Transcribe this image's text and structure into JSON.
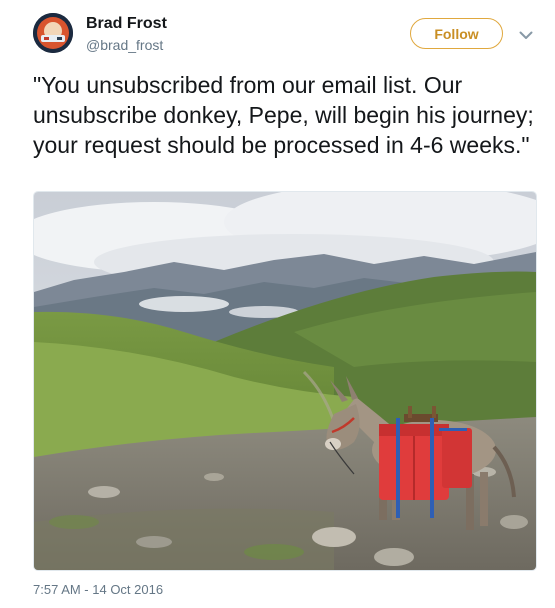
{
  "tweet": {
    "author": {
      "display_name": "Brad Frost",
      "handle": "@brad_frost",
      "avatar_icon": "avatar-photo"
    },
    "follow_label": "Follow",
    "menu_icon": "chevron-down-icon",
    "text": "\"You unsubscribed from our email list. Our unsubscribe donkey, Pepe, will begin his journey; your request should be processed in 4-6 weeks.\"",
    "timestamp": "7:57 AM - 14 Oct 2016",
    "colors": {
      "follow_accent": "#e0a83e",
      "text": "#14171a",
      "secondary": "#657786"
    }
  }
}
